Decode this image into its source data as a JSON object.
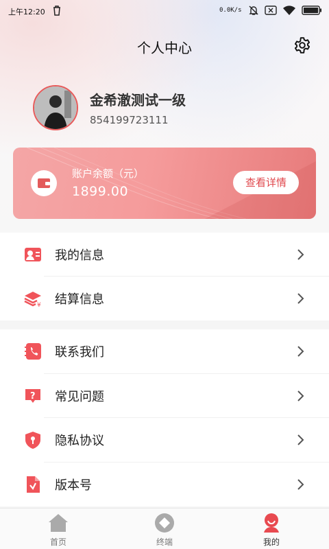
{
  "status_bar": {
    "time": "上午12:20",
    "net_speed": "0.0K/s"
  },
  "header": {
    "title": "个人中心",
    "settings_icon": "gear-icon"
  },
  "profile": {
    "name": "金希澈测试一级",
    "id": "854199723111"
  },
  "balance_card": {
    "label": "账户余额（元）",
    "amount": "1899.00",
    "button_label": "查看详情"
  },
  "menu_group1": [
    {
      "label": "我的信息",
      "icon": "user-card-icon"
    },
    {
      "label": "结算信息",
      "icon": "money-stack-icon"
    }
  ],
  "menu_group2": [
    {
      "label": "联系我们",
      "icon": "phone-book-icon"
    },
    {
      "label": "常见问题",
      "icon": "question-icon"
    },
    {
      "label": "隐私协议",
      "icon": "shield-lock-icon"
    },
    {
      "label": "版本号",
      "icon": "document-icon"
    }
  ],
  "tabbar": [
    {
      "label": "首页",
      "icon": "home-icon",
      "active": false
    },
    {
      "label": "终端",
      "icon": "terminal-icon",
      "active": false
    },
    {
      "label": "我的",
      "icon": "user-icon",
      "active": true
    }
  ],
  "colors": {
    "accent": "#e84a50",
    "card_start": "#f4a6a6",
    "card_end": "#e77b7b"
  }
}
